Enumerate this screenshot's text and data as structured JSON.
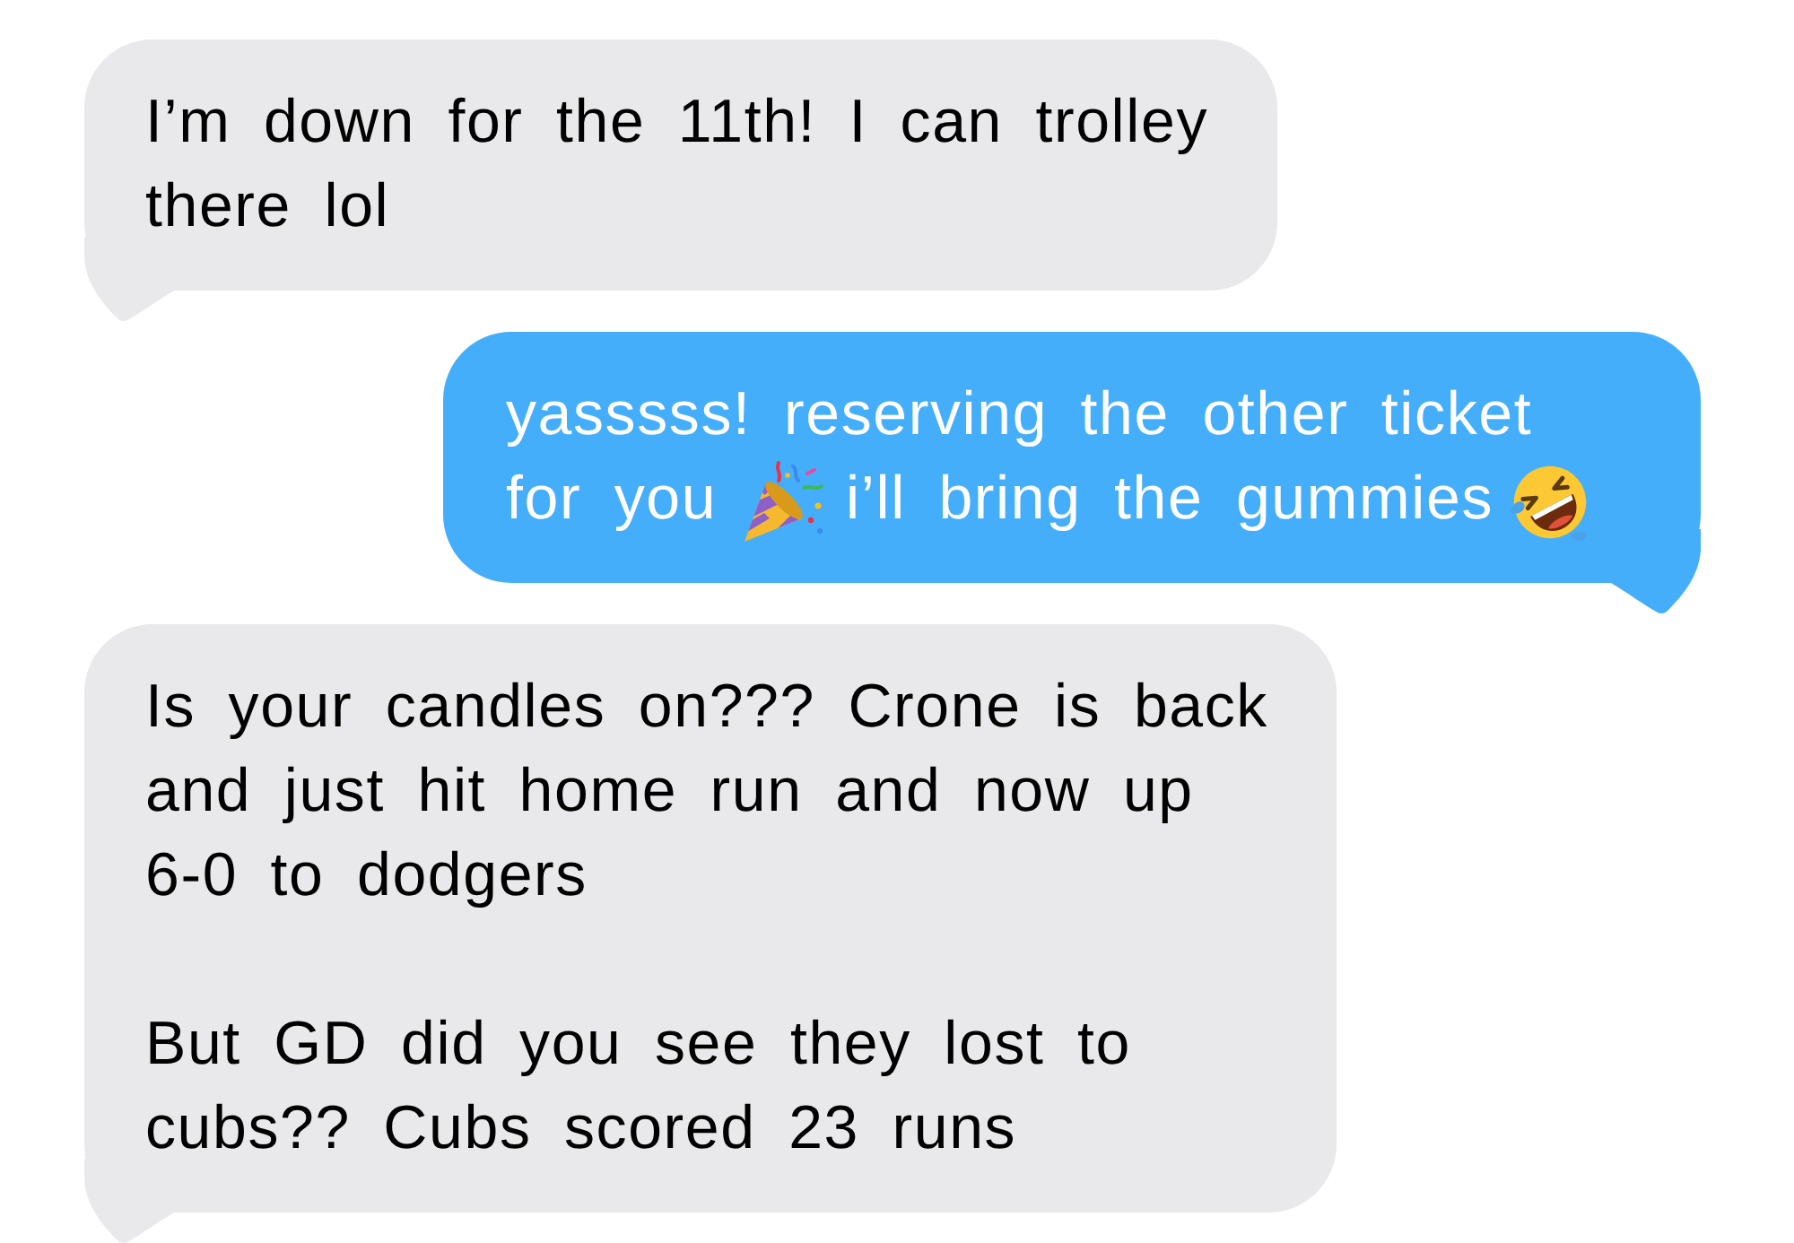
{
  "messages": [
    {
      "kind": "received",
      "paragraphs": [
        {
          "segments": [
            {
              "kind": "text",
              "text": "I’m down for the 11th! I can trolley there lol"
            }
          ]
        }
      ]
    },
    {
      "kind": "sent",
      "paragraphs": [
        {
          "segments": [
            {
              "kind": "text",
              "text": "yasssss! reserving the other ticket for you"
            },
            {
              "kind": "party_popper"
            },
            {
              "kind": "text",
              "text": "i’ll bring the gummies"
            },
            {
              "kind": "rolling_laughing"
            }
          ]
        }
      ]
    },
    {
      "kind": "received",
      "paragraphs": [
        {
          "segments": [
            {
              "kind": "text",
              "text": "Is your candles on??? Crone is back and just hit home run and now up 6-0 to dodgers"
            }
          ]
        },
        {
          "segments": [
            {
              "kind": "text",
              "text": "But GD did you see they lost to cubs?? Cubs scored 23 runs"
            }
          ]
        }
      ]
    }
  ]
}
